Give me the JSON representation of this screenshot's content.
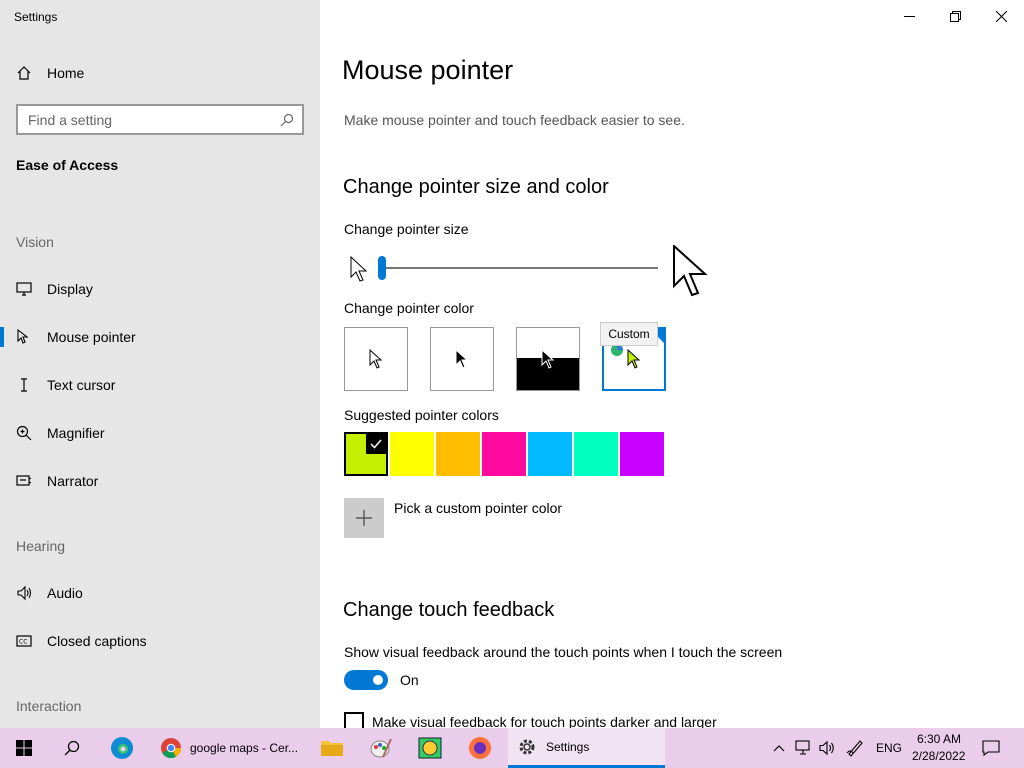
{
  "window": {
    "title": "Settings"
  },
  "sidebar": {
    "home_label": "Home",
    "search_placeholder": "Find a setting",
    "section_title": "Ease of Access",
    "groups": {
      "vision": "Vision",
      "hearing": "Hearing",
      "interaction": "Interaction"
    },
    "items": [
      {
        "label": "Display",
        "icon": "monitor-icon"
      },
      {
        "label": "Mouse pointer",
        "icon": "mouse-pointer-icon",
        "selected": true
      },
      {
        "label": "Text cursor",
        "icon": "text-cursor-icon"
      },
      {
        "label": "Magnifier",
        "icon": "magnifier-icon"
      },
      {
        "label": "Narrator",
        "icon": "narrator-icon"
      },
      {
        "label": "Audio",
        "icon": "speaker-icon"
      },
      {
        "label": "Closed captions",
        "icon": "closed-captions-icon"
      }
    ]
  },
  "main": {
    "title": "Mouse pointer",
    "description": "Make mouse pointer and touch feedback easier to see.",
    "size_color_heading": "Change pointer size and color",
    "pointer_size_label": "Change pointer size",
    "pointer_size_value": 1,
    "pointer_color_label": "Change pointer color",
    "color_options": [
      "White",
      "Black",
      "Inverted",
      "Custom"
    ],
    "selected_color_option": "Custom",
    "tooltip": "Custom",
    "suggested_label": "Suggested pointer colors",
    "suggested_colors": [
      "#c4f000",
      "#ffff00",
      "#ffbe00",
      "#ff0aa0",
      "#00b9ff",
      "#00ffc0",
      "#c800ff"
    ],
    "selected_suggested_index": 0,
    "custom_color_label": "Pick a custom pointer color",
    "touch_heading": "Change touch feedback",
    "touch_feedback_label": "Show visual feedback around the touch points when I touch the screen",
    "touch_toggle_state": "On",
    "darker_checkbox_label": "Make visual feedback for touch points darker and larger"
  },
  "taskbar": {
    "apps": [
      {
        "label": "google maps - Cer...",
        "icon": "chrome-icon"
      },
      {
        "label": "Settings",
        "icon": "gear-icon",
        "active": true
      }
    ],
    "language": "ENG",
    "time": "6:30 AM",
    "date": "2/28/2022"
  },
  "colors": {
    "accent": "#0078d4",
    "sidebar_bg": "#e6e6e6",
    "taskbar_bg": "#e9cdea"
  }
}
